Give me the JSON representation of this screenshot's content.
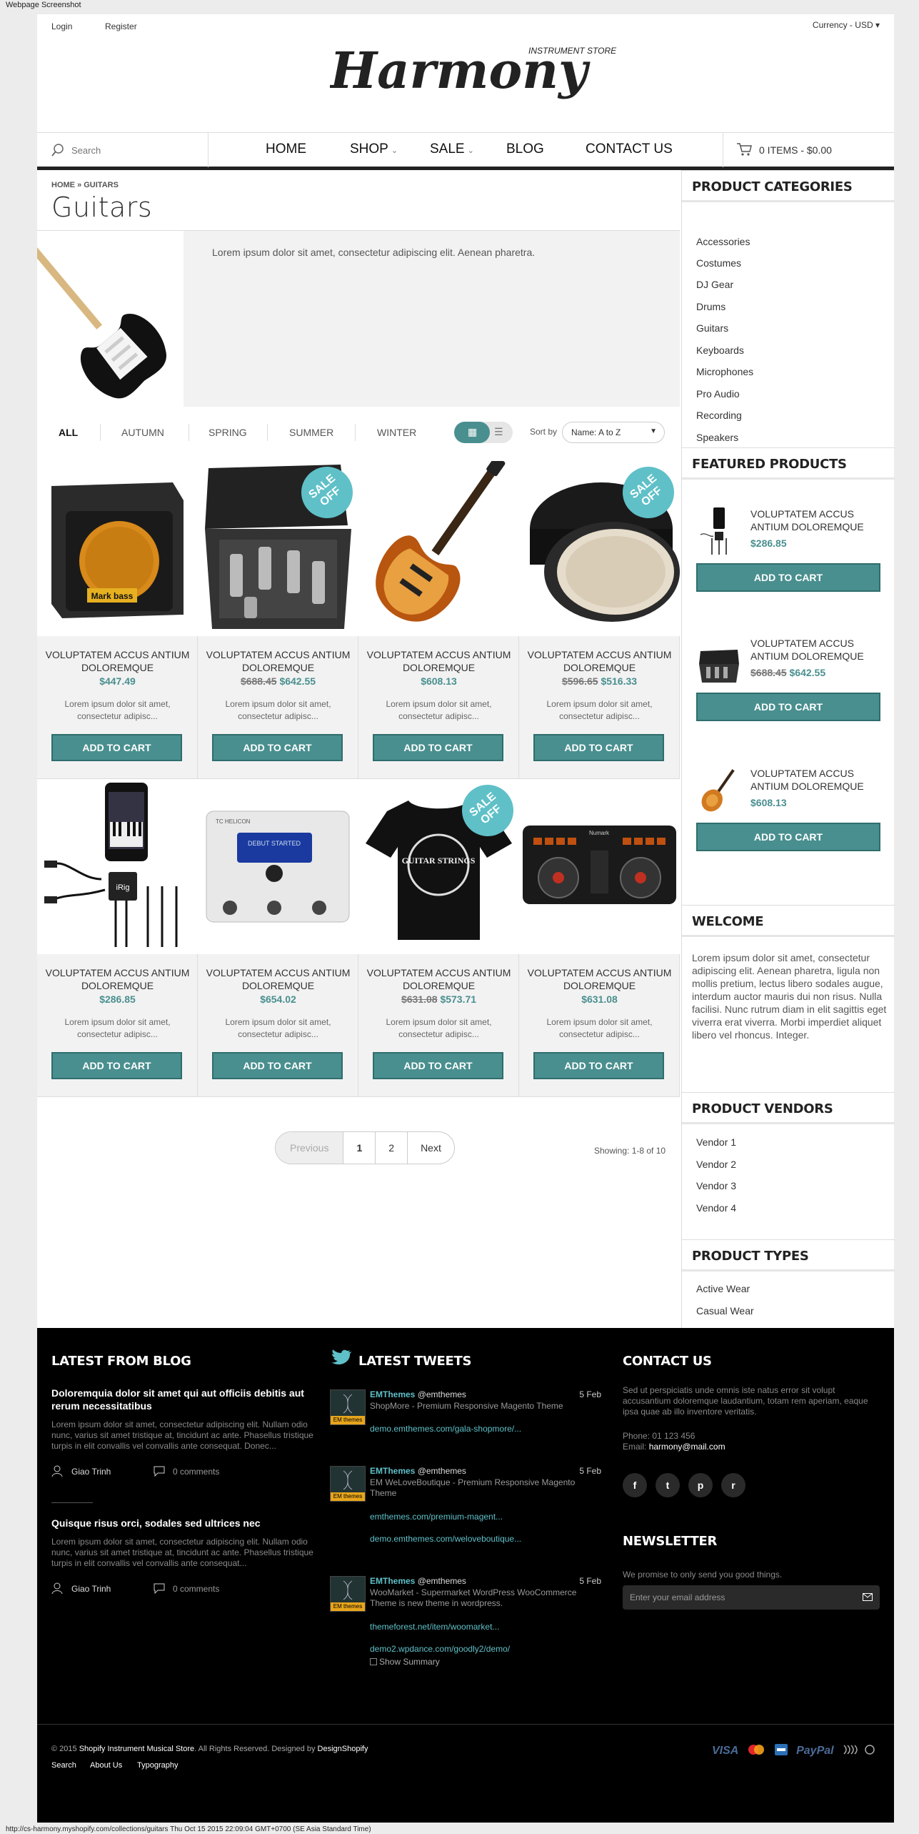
{
  "screenshot_label": "Webpage Screenshot",
  "footer_url": "http://cs-harmony.myshopify.com/collections/guitars Thu Oct 15 2015 22:09:04 GMT+0700 (SE Asia Standard Time)",
  "header": {
    "login": "Login",
    "register": "Register",
    "currency_label": "Currency -",
    "currency_value": "USD",
    "logo_tagline": "INSTRUMENT STORE",
    "logo_text": "Harmony"
  },
  "nav": {
    "search_placeholder": "Search",
    "items": [
      "HOME",
      "SHOP",
      "SALE",
      "BLOG",
      "CONTACT US"
    ],
    "cart": "0 ITEMS - $0.00"
  },
  "breadcrumb": {
    "home": "HOME",
    "sep": "»",
    "current": "GUITARS"
  },
  "page_title": "Guitars",
  "banner_text": "Lorem ipsum dolor sit amet, consectetur adipiscing elit. Aenean pharetra.",
  "filters": [
    "ALL",
    "AUTUMN",
    "SPRING",
    "SUMMER",
    "WINTER"
  ],
  "sort": {
    "label": "Sort by",
    "value": "Name: A to Z"
  },
  "products": [
    {
      "name": "VOLUPTATEM ACCUS ANTIUM DOLOREMQUE",
      "old": "",
      "price": "$447.49",
      "desc": "Lorem ipsum dolor sit amet, consectetur adipisc...",
      "btn": "ADD TO CART",
      "sale": false
    },
    {
      "name": "VOLUPTATEM ACCUS ANTIUM DOLOREMQUE",
      "old": "$688.45",
      "price": "$642.55",
      "desc": "Lorem ipsum dolor sit amet, consectetur adipisc...",
      "btn": "ADD TO CART",
      "sale": true
    },
    {
      "name": "VOLUPTATEM ACCUS ANTIUM DOLOREMQUE",
      "old": "",
      "price": "$608.13",
      "desc": "Lorem ipsum dolor sit amet, consectetur adipisc...",
      "btn": "ADD TO CART",
      "sale": false
    },
    {
      "name": "VOLUPTATEM ACCUS ANTIUM DOLOREMQUE",
      "old": "$596.65",
      "price": "$516.33",
      "desc": "Lorem ipsum dolor sit amet, consectetur adipisc...",
      "btn": "ADD TO CART",
      "sale": true
    },
    {
      "name": "VOLUPTATEM ACCUS ANTIUM DOLOREMQUE",
      "old": "",
      "price": "$286.85",
      "desc": "Lorem ipsum dolor sit amet, consectetur adipisc...",
      "btn": "ADD TO CART",
      "sale": false
    },
    {
      "name": "VOLUPTATEM ACCUS ANTIUM DOLOREMQUE",
      "old": "",
      "price": "$654.02",
      "desc": "Lorem ipsum dolor sit amet, consectetur adipisc...",
      "btn": "ADD TO CART",
      "sale": false
    },
    {
      "name": "VOLUPTATEM ACCUS ANTIUM DOLOREMQUE",
      "old": "$631.08",
      "price": "$573.71",
      "desc": "Lorem ipsum dolor sit amet, consectetur adipisc...",
      "btn": "ADD TO CART",
      "sale": true
    },
    {
      "name": "VOLUPTATEM ACCUS ANTIUM DOLOREMQUE",
      "old": "",
      "price": "$631.08",
      "desc": "Lorem ipsum dolor sit amet, consectetur adipisc...",
      "btn": "ADD TO CART",
      "sale": false
    }
  ],
  "sale_badge": {
    "line1": "SALE",
    "line2": "OFF"
  },
  "image_labels": {
    "mark_bass": "Mark bass",
    "irig": "iRig",
    "helicon": "TC HELICON",
    "helicon_screen": "DEBUT STARTED",
    "shirt": "GUITAR STRINGS",
    "numark": "Numark"
  },
  "pagination": {
    "prev": "Previous",
    "pages": [
      "1",
      "2"
    ],
    "next": "Next",
    "showing": "Showing: 1-8 of 10"
  },
  "sidebar": {
    "categories_title": "PRODUCT CATEGORIES",
    "categories": [
      "Accessories",
      "Costumes",
      "DJ Gear",
      "Drums",
      "Guitars",
      "Keyboards",
      "Microphones",
      "Pro Audio",
      "Recording",
      "Speakers"
    ],
    "featured_title": "FEATURED PRODUCTS",
    "featured": [
      {
        "name": "VOLUPTATEM ACCUS ANTIUM DOLOREMQUE",
        "old": "",
        "price": "$286.85",
        "btn": "ADD TO CART"
      },
      {
        "name": "VOLUPTATEM ACCUS ANTIUM DOLOREMQUE",
        "old": "$688.45",
        "price": "$642.55",
        "btn": "ADD TO CART"
      },
      {
        "name": "VOLUPTATEM ACCUS ANTIUM DOLOREMQUE",
        "old": "",
        "price": "$608.13",
        "btn": "ADD TO CART"
      }
    ],
    "welcome_title": "WELCOME",
    "welcome_text": "Lorem ipsum dolor sit amet, consectetur adipiscing elit. Aenean pharetra, ligula non mollis pretium, lectus libero sodales augue, interdum auctor mauris dui non risus. Nulla facilisi. Nunc rutrum diam in elit sagittis eget viverra erat viverra. Morbi imperdiet aliquet libero vel rhoncus. Integer.",
    "vendors_title": "PRODUCT VENDORS",
    "vendors": [
      "Vendor 1",
      "Vendor 2",
      "Vendor 3",
      "Vendor 4"
    ],
    "types_title": "PRODUCT TYPES",
    "types": [
      "Active Wear",
      "Casual Wear"
    ]
  },
  "footer": {
    "blog_title": "LATEST FROM BLOG",
    "posts": [
      {
        "title": "Doloremquia dolor sit amet qui aut officiis debitis aut rerum necessitatibus",
        "excerpt": "Lorem ipsum dolor sit amet, consectetur adipiscing elit. Nullam odio nunc, varius sit amet tristique at, tincidunt ac ante. Phasellus tristique turpis in elit convallis vel convallis ante consequat. Donec...",
        "author": "Giao Trinh",
        "comments": "0 comments"
      },
      {
        "title": "Quisque risus orci, sodales sed ultrices nec",
        "excerpt": "Lorem ipsum dolor sit amet, consectetur adipiscing elit. Nullam odio nunc, varius sit amet tristique at, tincidunt ac ante. Phasellus tristique turpis in elit convallis vel convallis ante consequat...",
        "author": "Giao Trinh",
        "comments": "0 comments"
      }
    ],
    "tweets_title": "LATEST TWEETS",
    "tweets": [
      {
        "name": "EMThemes",
        "handle": "@emthemes",
        "date": "5 Feb",
        "text": "ShopMore - Premium Responsive Magento Theme",
        "links": [
          "demo.emthemes.com/gala-shopmore/..."
        ],
        "avatar_label": "EM themes"
      },
      {
        "name": "EMThemes",
        "handle": "@emthemes",
        "date": "5 Feb",
        "text": "EM WeLoveBoutique - Premium Responsive Magento Theme",
        "links": [
          "emthemes.com/premium-magent...",
          "demo.emthemes.com/weloveboutique..."
        ],
        "avatar_label": "EM themes"
      },
      {
        "name": "EMThemes",
        "handle": "@emthemes",
        "date": "5 Feb",
        "text": "WooMarket - Supermarket WordPress WooCommerce Theme is new theme in wordpress.",
        "links": [
          "themeforest.net/item/woomarket...",
          "demo2.wpdance.com/goodly2/demo/"
        ],
        "avatar_label": "EM themes"
      }
    ],
    "show_summary": "Show Summary",
    "contact_title": "CONTACT US",
    "contact_text": "Sed ut perspiciatis unde omnis iste natus error sit volupt accusantium doloremque laudantium, totam rem aperiam, eaque ipsa quae ab illo inventore veritatis.",
    "phone": "Phone: 01 123 456",
    "email_label": "Email:",
    "email": "harmony@mail.com",
    "social": [
      "f",
      "t",
      "p",
      "r"
    ],
    "newsletter_title": "NEWSLETTER",
    "newsletter_text": "We promise to only send you good things.",
    "newsletter_placeholder": "Enter your email address",
    "copyright_pre": "© 2015",
    "store_name": "Shopify Instrument Musical Store",
    "copyright_mid": ". All Rights Reserved. Designed by",
    "designer": "DesignShopify",
    "links": [
      "Search",
      "About Us",
      "Typography"
    ],
    "payments": [
      "VISA",
      "MasterCard",
      "Amex",
      "PayPal",
      "Contactless"
    ]
  },
  "colors": {
    "accent": "#4a8f8f",
    "sale_badge": "#5fc0c8",
    "footer_bg": "#000000"
  }
}
